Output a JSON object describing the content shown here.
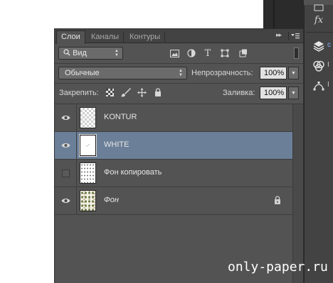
{
  "tabs": [
    "Слои",
    "Каналы",
    "Контуры"
  ],
  "tab_menu": "▸▸",
  "filter": {
    "label": "Вид"
  },
  "blend": {
    "mode": "Обычные"
  },
  "opacity": {
    "label": "Непрозрачность:",
    "value": "100%"
  },
  "lock": {
    "label": "Закрепить:"
  },
  "fill": {
    "label": "Заливка:",
    "value": "100%"
  },
  "layers": [
    {
      "name": "KONTUR",
      "visible": true,
      "selected": false
    },
    {
      "name": "WHITE",
      "visible": true,
      "selected": true
    },
    {
      "name": "Фон копировать",
      "visible": false,
      "selected": false
    },
    {
      "name": "Фон",
      "visible": true,
      "selected": false,
      "locked": true
    }
  ],
  "dock": {
    "fx_label": "fx",
    "letters": [
      "c",
      "I",
      "I"
    ]
  },
  "watermark": "only-paper.ru",
  "colors": {
    "panel_bg": "#535353",
    "selected_row": "#6b7f98",
    "dark_dock": "#2b2b2b"
  }
}
